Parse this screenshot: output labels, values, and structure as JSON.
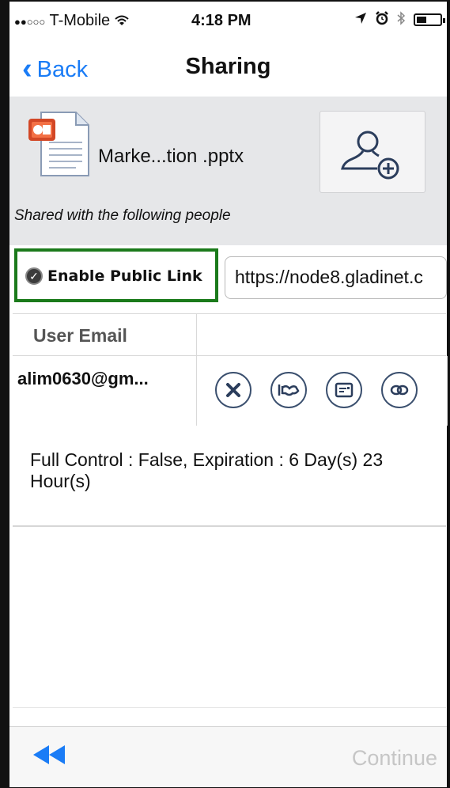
{
  "status_bar": {
    "signal": "●●○○○",
    "carrier": "T-Mobile",
    "wifi": "wifi-icon",
    "time": "4:18 PM",
    "icons": [
      "location-icon",
      "alarm-icon",
      "bluetooth-icon",
      "battery-icon"
    ]
  },
  "nav": {
    "back_label": "Back",
    "title": "Sharing"
  },
  "file": {
    "name": "Marke...tion .pptx",
    "icon": "powerpoint-file-icon",
    "shared_with_label": "Shared with the following people"
  },
  "public_link": {
    "enabled": true,
    "label": "Enable Public Link",
    "url": "https://node8.gladinet.c"
  },
  "table": {
    "headers": [
      "User Email",
      ""
    ],
    "rows": [
      {
        "email": "alim0630@gm...",
        "actions": [
          "remove-icon",
          "handshake-icon",
          "contact-card-icon",
          "link-icon"
        ],
        "details": "Full Control : False, Expiration : 6 Day(s) 23 Hour(s)"
      }
    ]
  },
  "toolbar": {
    "rewind_icon": "rewind-icon",
    "continue_label": "Continue"
  },
  "colors": {
    "accent": "#1a7cf6",
    "highlight_border": "#1b7a1b",
    "header_bg": "#e6e7e9",
    "action_stroke": "#3a4f6e",
    "disabled_text": "#c6c6c6"
  }
}
